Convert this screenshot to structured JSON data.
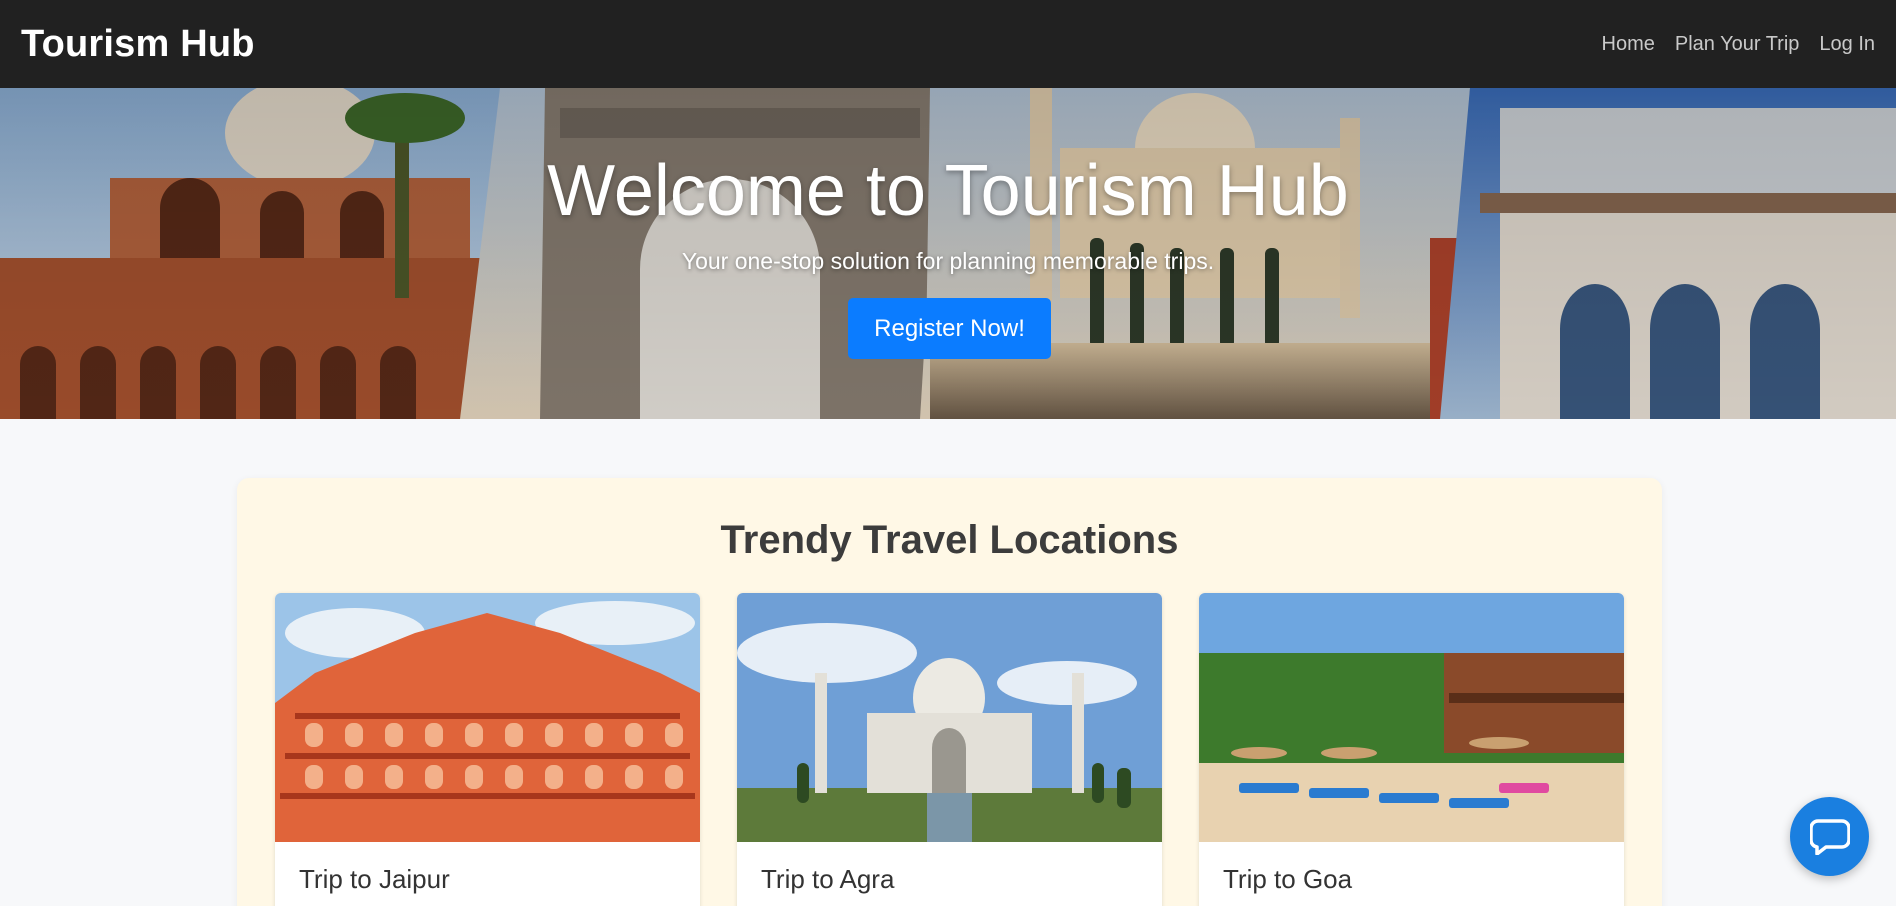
{
  "navbar": {
    "brand": "Tourism Hub",
    "links": [
      "Home",
      "Plan Your Trip",
      "Log In"
    ]
  },
  "hero": {
    "title": "Welcome to Tourism Hub",
    "subtitle": "Your one-stop solution for planning memorable trips.",
    "button_label": "Register Now!"
  },
  "trending": {
    "title": "Trendy Travel Locations",
    "cards": [
      {
        "title": "Trip to Jaipur"
      },
      {
        "title": "Trip to Agra"
      },
      {
        "title": "Trip to Goa"
      }
    ]
  },
  "chat": {
    "icon": "chat-bubble-icon"
  },
  "colors": {
    "navbar": "#212121",
    "accent": "#0b7cff",
    "chat": "#1a7fe0",
    "section_bg": "#fff8e6"
  }
}
